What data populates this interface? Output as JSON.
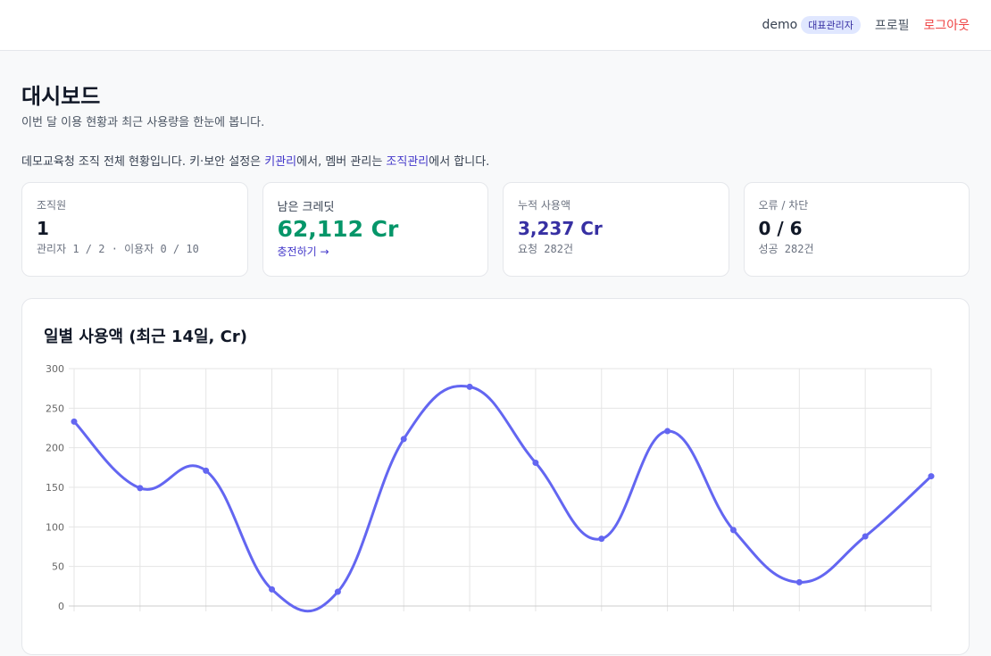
{
  "header": {
    "username": "demo",
    "role_badge": "대표관리자",
    "profile_label": "프로필",
    "logout_label": "로그아웃"
  },
  "page": {
    "title": "대시보드",
    "subtitle": "이번 달 이용 현황과 최근 사용량을 한눈에 봅니다."
  },
  "notice": {
    "part1": "데모교육청 조직 전체 현황입니다. 키·보안 설정은 ",
    "link1": "키관리",
    "part2": "에서, 멤버 관리는 ",
    "link2": "조직관리",
    "part3": "에서 합니다."
  },
  "cards": {
    "members": {
      "label": "조직원",
      "value": "1",
      "sub": "관리자 1 / 2 · 이용자 0 / 10"
    },
    "credits": {
      "label": "남은 크레딧",
      "value": "62,112 Cr",
      "link": "충전하기 →"
    },
    "usage": {
      "label": "누적 사용액",
      "value": "3,237 Cr",
      "sub": "요청 282건"
    },
    "errors": {
      "label": "오류 / 차단",
      "value": "0 / 6",
      "sub": "성공 282건"
    }
  },
  "chart_title": "일별 사용액 (최근 14일, Cr)",
  "colors": {
    "line": "#6366f1",
    "credits_value": "#059669",
    "usage_value": "#3730a3",
    "link": "#4338ca",
    "logout": "#ef4444"
  },
  "chart_data": {
    "type": "line",
    "x": [
      "",
      "",
      "",
      "",
      "",
      "",
      "",
      "",
      "",
      "",
      "",
      "",
      "",
      ""
    ],
    "values": [
      233,
      149,
      171,
      21,
      18,
      211,
      277,
      181,
      85,
      221,
      96,
      30,
      88,
      164
    ],
    "ylim": [
      0,
      300
    ],
    "yticks": [
      0,
      50,
      100,
      150,
      200,
      250,
      300
    ],
    "grid": true,
    "title": "",
    "xlabel": "",
    "ylabel": ""
  }
}
